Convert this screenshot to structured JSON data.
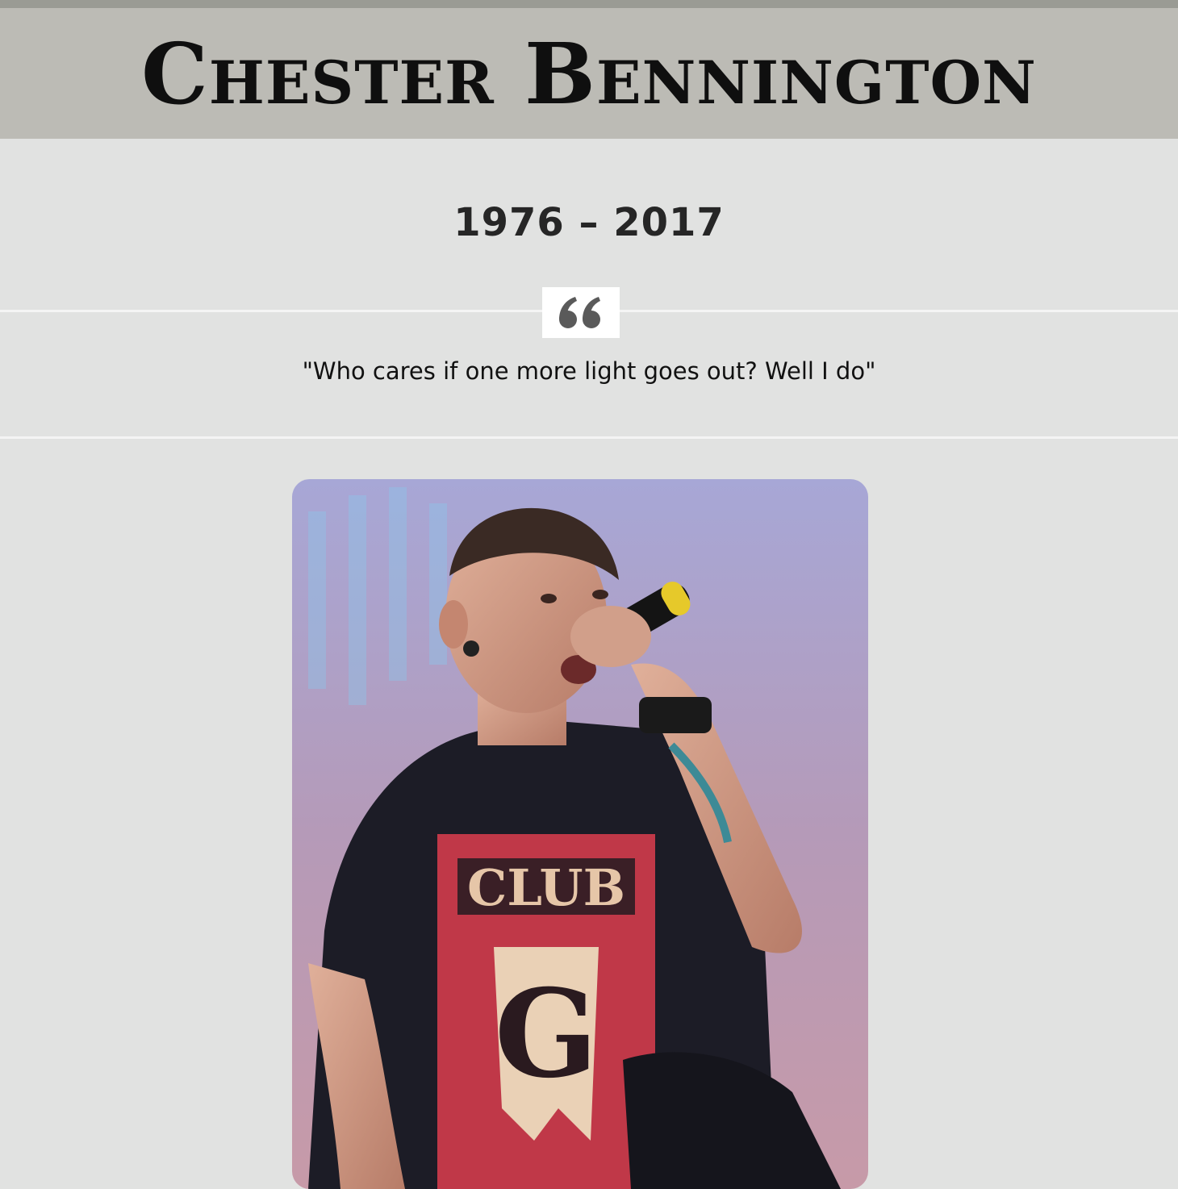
{
  "header": {
    "title": "Chester Bennington",
    "background_color": "#bcbbb5"
  },
  "tribute": {
    "years": "1976 – 2017",
    "quote_icon": "quote-left-icon",
    "quote": "\"Who cares if one more light goes out? Well I do\""
  },
  "photo": {
    "subject": "performer-singing-into-microphone"
  }
}
